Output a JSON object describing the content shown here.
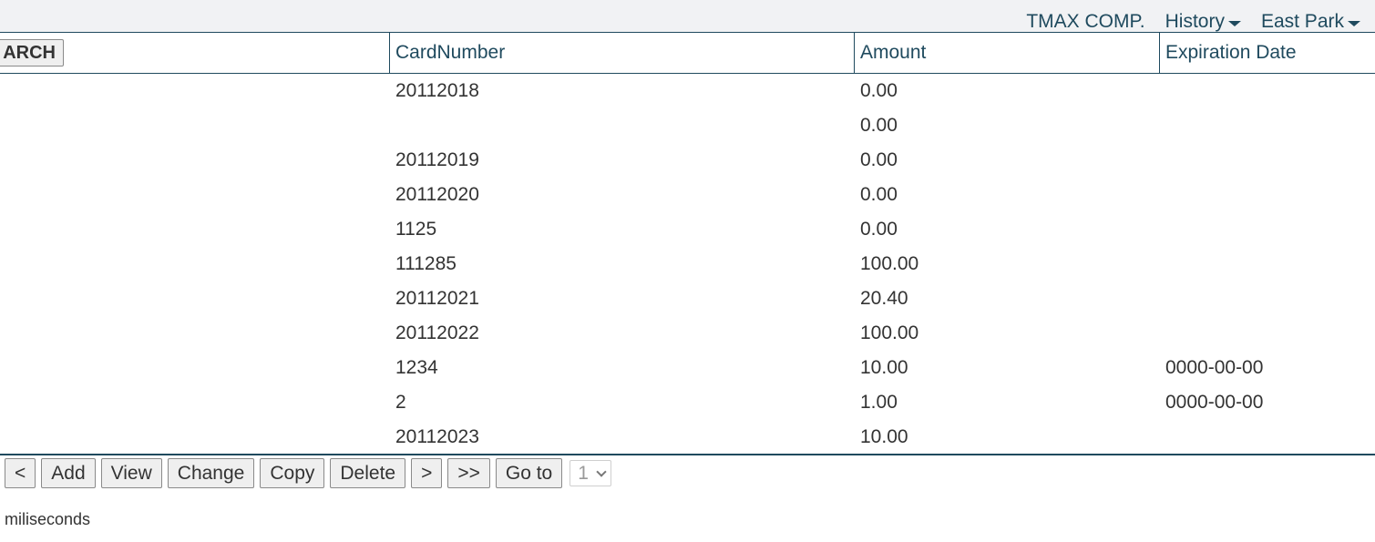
{
  "topnav": {
    "company": "TMAX COMP.",
    "menus": [
      {
        "label": "History"
      },
      {
        "label": "East Park"
      }
    ]
  },
  "table": {
    "search_button": "ARCH",
    "columns": [
      "CardNumber",
      "Amount",
      "Expiration Date"
    ],
    "rows": [
      {
        "card": "20112018",
        "amount": "0.00",
        "exp": ""
      },
      {
        "card": "",
        "amount": "0.00",
        "exp": ""
      },
      {
        "card": "20112019",
        "amount": "0.00",
        "exp": ""
      },
      {
        "card": "20112020",
        "amount": "0.00",
        "exp": ""
      },
      {
        "card": "1125",
        "amount": "0.00",
        "exp": ""
      },
      {
        "card": "111285",
        "amount": "100.00",
        "exp": ""
      },
      {
        "card": "20112021",
        "amount": "20.40",
        "exp": ""
      },
      {
        "card": "20112022",
        "amount": "100.00",
        "exp": ""
      },
      {
        "card": "1234",
        "amount": "10.00",
        "exp": "0000-00-00"
      },
      {
        "card": "2",
        "amount": "1.00",
        "exp": "0000-00-00"
      },
      {
        "card": "20112023",
        "amount": "10.00",
        "exp": ""
      }
    ]
  },
  "toolbar": {
    "prev": "<",
    "add": "Add",
    "view": "View",
    "change": "Change",
    "copy": "Copy",
    "delete": "Delete",
    "next": ">",
    "last": ">>",
    "goto": "Go to",
    "page_selected": "1"
  },
  "status": {
    "text": "miliseconds"
  }
}
